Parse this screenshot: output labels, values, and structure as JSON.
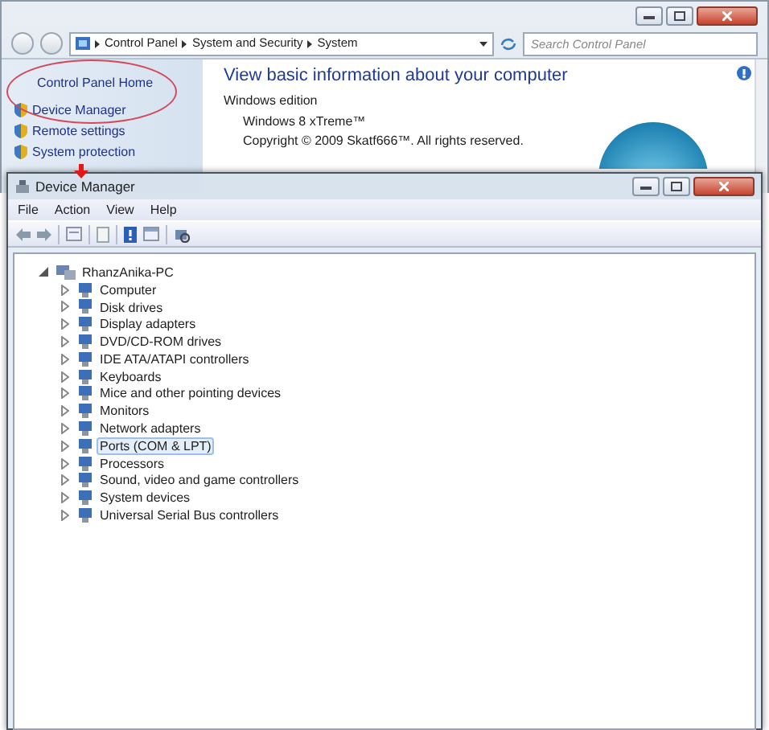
{
  "control_panel": {
    "breadcrumbs": [
      "Control Panel",
      "System and Security",
      "System"
    ],
    "search": {
      "placeholder": "Search Control Panel"
    },
    "sidebar": [
      {
        "label": "Control Panel Home",
        "kind": "home"
      },
      {
        "label": "Device Manager",
        "kind": "task"
      },
      {
        "label": "Remote settings",
        "kind": "task"
      },
      {
        "label": "System protection",
        "kind": "task"
      }
    ],
    "heading": "View basic information about your computer",
    "section": "Windows edition",
    "edition": "Windows 8 xTreme™",
    "copyright": "Copyright © 2009 Skatf666™. All rights reserved."
  },
  "device_manager": {
    "title": "Device Manager",
    "menu": [
      "File",
      "Action",
      "View",
      "Help"
    ],
    "tree": {
      "label": "RhanzAnika-PC",
      "expanded": true,
      "children": [
        {
          "label": "Computer",
          "expanded": false,
          "selected": false
        },
        {
          "label": "Disk drives",
          "expanded": false,
          "selected": false
        },
        {
          "label": "Display adapters",
          "expanded": false,
          "selected": false
        },
        {
          "label": "DVD/CD-ROM drives",
          "expanded": false,
          "selected": false
        },
        {
          "label": "IDE ATA/ATAPI controllers",
          "expanded": false,
          "selected": false
        },
        {
          "label": "Keyboards",
          "expanded": false,
          "selected": false
        },
        {
          "label": "Mice and other pointing devices",
          "expanded": false,
          "selected": false
        },
        {
          "label": "Monitors",
          "expanded": false,
          "selected": false
        },
        {
          "label": "Network adapters",
          "expanded": false,
          "selected": false
        },
        {
          "label": "Ports (COM & LPT)",
          "expanded": false,
          "selected": true
        },
        {
          "label": "Processors",
          "expanded": false,
          "selected": false
        },
        {
          "label": "Sound, video and game controllers",
          "expanded": false,
          "selected": false
        },
        {
          "label": "System devices",
          "expanded": false,
          "selected": false
        },
        {
          "label": "Universal Serial Bus controllers",
          "expanded": false,
          "selected": false
        }
      ]
    }
  }
}
